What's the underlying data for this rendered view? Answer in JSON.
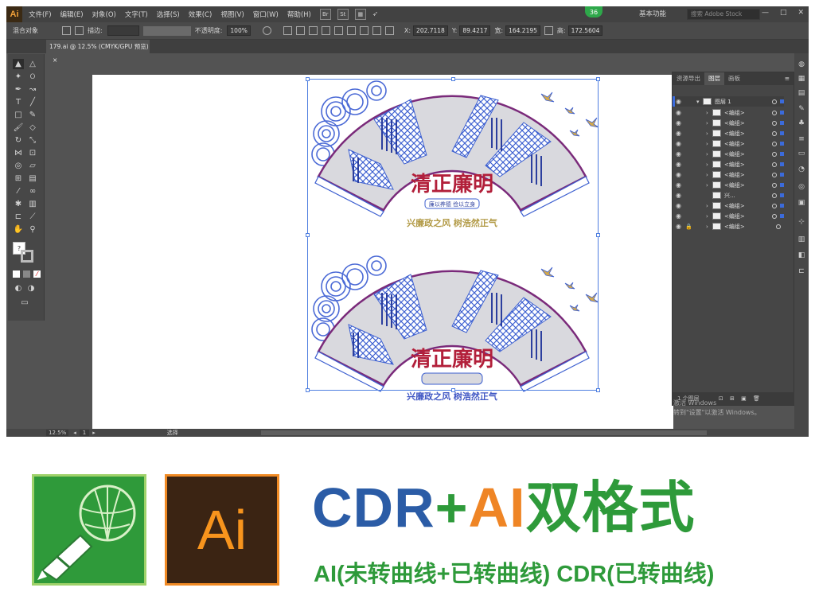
{
  "app": {
    "logo": "Ai",
    "menu": [
      "文件(F)",
      "编辑(E)",
      "对象(O)",
      "文字(T)",
      "选择(S)",
      "效果(C)",
      "视图(V)",
      "窗口(W)",
      "帮助(H)"
    ],
    "br_icon": "Br",
    "st_icon": "St",
    "sync_count": "36",
    "workspace": "基本功能",
    "stock_search_placeholder": "搜索 Adobe Stock",
    "window_controls": [
      "—",
      "□",
      "✕"
    ]
  },
  "control_bar": {
    "object_type": "混合对象",
    "stroke_label": "描边:",
    "opacity_label": "不透明度:",
    "opacity_value": "100%",
    "x_label": "X:",
    "x_value": "202.7118",
    "y_label": "Y:",
    "y_value": "89.4217",
    "w_label": "宽:",
    "w_value": "164.2195",
    "h_label": "高:",
    "h_value": "172.5604"
  },
  "document": {
    "tab_title": "179.ai @ 12.5% (CMYK/GPU 预览)",
    "tab_close": "×"
  },
  "artwork": {
    "title": "清正廉明",
    "subtitle_top": "廉以养德 俭以立身",
    "slogan": "兴廉政之风  树浩然正气"
  },
  "layers_panel": {
    "tabs": [
      "资源导出",
      "图层",
      "画板"
    ],
    "active_tab": "图层",
    "top_layer": "图层 1",
    "items": [
      "<编组>",
      "<编组>",
      "<编组>",
      "<编组>",
      "<编组>",
      "<编组>",
      "<编组>",
      "<编组>",
      "兴...",
      "<编组>",
      "<编组>",
      "<编组>"
    ],
    "footer": "1 个图层"
  },
  "activation": {
    "line1": "激活 Windows",
    "line2": "转到\"设置\"以激活 Windows。"
  },
  "status_bar": {
    "zoom": "12.5%",
    "artboard": "1",
    "tool": "选择"
  },
  "promo": {
    "logo_ai": "Ai",
    "headline_cdr": "CDR",
    "headline_plus": "+",
    "headline_ai": "AI",
    "headline_format": "双格式",
    "subline": "AI(未转曲线+已转曲线) CDR(已转曲线)"
  }
}
